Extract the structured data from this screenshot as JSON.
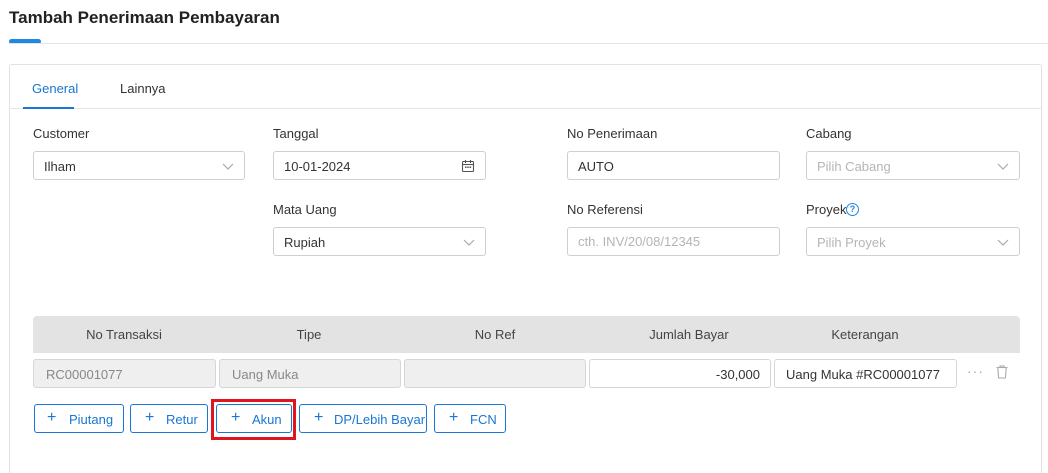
{
  "page": {
    "title": "Tambah Penerimaan Pembayaran"
  },
  "tabs": [
    {
      "label": "General",
      "active": true
    },
    {
      "label": "Lainnya",
      "active": false
    }
  ],
  "form": {
    "customer": {
      "label": "Customer",
      "value": "Ilham"
    },
    "tanggal": {
      "label": "Tanggal",
      "value": "10-01-2024"
    },
    "no_penerimaan": {
      "label": "No Penerimaan",
      "value": "AUTO"
    },
    "cabang": {
      "label": "Cabang",
      "placeholder": "Pilih Cabang"
    },
    "mata_uang": {
      "label": "Mata Uang",
      "value": "Rupiah"
    },
    "no_referensi": {
      "label": "No Referensi",
      "placeholder": "cth. INV/20/08/12345"
    },
    "proyek": {
      "label": "Proyek",
      "placeholder": "Pilih Proyek",
      "help_icon": "question-circle-icon"
    }
  },
  "table": {
    "columns": [
      "No Transaksi",
      "Tipe",
      "No Ref",
      "Jumlah Bayar",
      "Keterangan"
    ],
    "rows": [
      {
        "no_transaksi": "RC00001077",
        "tipe": "Uang Muka",
        "no_ref": "",
        "jumlah_bayar": "-30,000",
        "keterangan": "Uang Muka #RC00001077"
      }
    ]
  },
  "actions": [
    {
      "label": "Piutang"
    },
    {
      "label": "Retur"
    },
    {
      "label": "Akun",
      "highlighted": true
    },
    {
      "label": "DP/Lebih Bayar"
    },
    {
      "label": "FCN"
    }
  ],
  "colors": {
    "accent": "#1976d2",
    "highlight": "#e0141e"
  }
}
